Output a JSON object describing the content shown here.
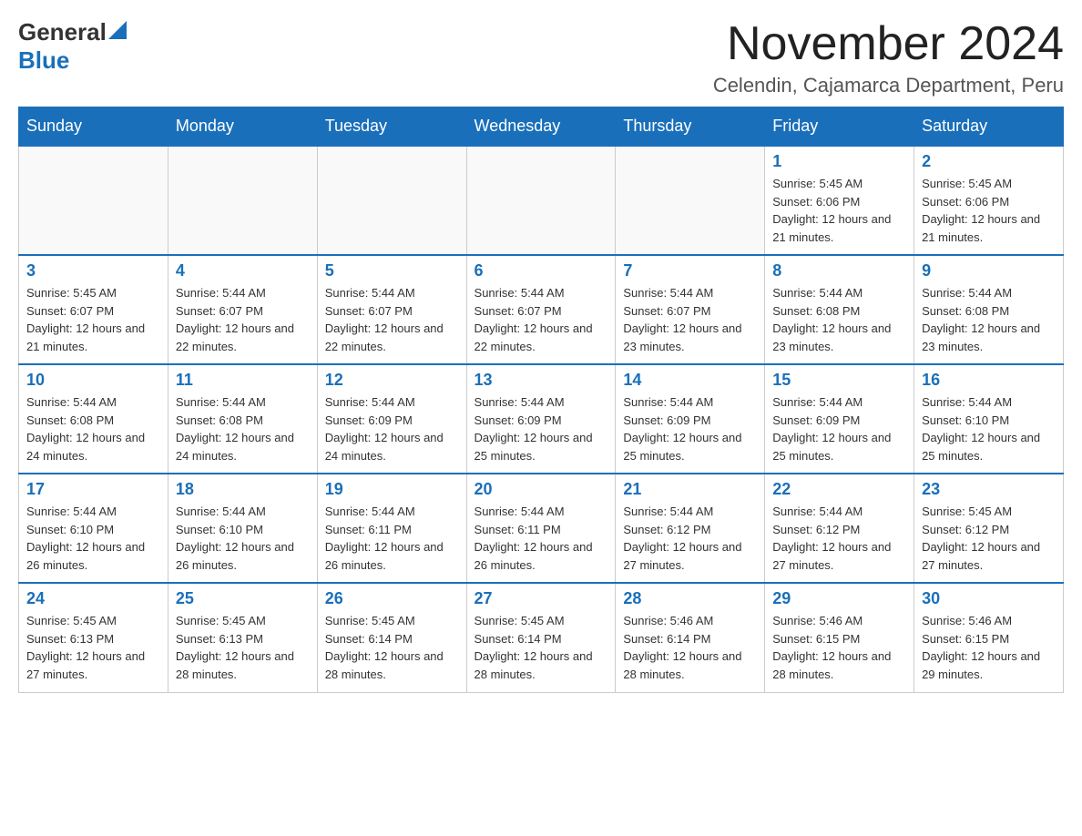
{
  "header": {
    "logo_general": "General",
    "logo_blue": "Blue",
    "month_title": "November 2024",
    "location": "Celendin, Cajamarca Department, Peru"
  },
  "days_of_week": [
    "Sunday",
    "Monday",
    "Tuesday",
    "Wednesday",
    "Thursday",
    "Friday",
    "Saturday"
  ],
  "weeks": [
    [
      {
        "day": "",
        "info": ""
      },
      {
        "day": "",
        "info": ""
      },
      {
        "day": "",
        "info": ""
      },
      {
        "day": "",
        "info": ""
      },
      {
        "day": "",
        "info": ""
      },
      {
        "day": "1",
        "info": "Sunrise: 5:45 AM\nSunset: 6:06 PM\nDaylight: 12 hours and 21 minutes."
      },
      {
        "day": "2",
        "info": "Sunrise: 5:45 AM\nSunset: 6:06 PM\nDaylight: 12 hours and 21 minutes."
      }
    ],
    [
      {
        "day": "3",
        "info": "Sunrise: 5:45 AM\nSunset: 6:07 PM\nDaylight: 12 hours and 21 minutes."
      },
      {
        "day": "4",
        "info": "Sunrise: 5:44 AM\nSunset: 6:07 PM\nDaylight: 12 hours and 22 minutes."
      },
      {
        "day": "5",
        "info": "Sunrise: 5:44 AM\nSunset: 6:07 PM\nDaylight: 12 hours and 22 minutes."
      },
      {
        "day": "6",
        "info": "Sunrise: 5:44 AM\nSunset: 6:07 PM\nDaylight: 12 hours and 22 minutes."
      },
      {
        "day": "7",
        "info": "Sunrise: 5:44 AM\nSunset: 6:07 PM\nDaylight: 12 hours and 23 minutes."
      },
      {
        "day": "8",
        "info": "Sunrise: 5:44 AM\nSunset: 6:08 PM\nDaylight: 12 hours and 23 minutes."
      },
      {
        "day": "9",
        "info": "Sunrise: 5:44 AM\nSunset: 6:08 PM\nDaylight: 12 hours and 23 minutes."
      }
    ],
    [
      {
        "day": "10",
        "info": "Sunrise: 5:44 AM\nSunset: 6:08 PM\nDaylight: 12 hours and 24 minutes."
      },
      {
        "day": "11",
        "info": "Sunrise: 5:44 AM\nSunset: 6:08 PM\nDaylight: 12 hours and 24 minutes."
      },
      {
        "day": "12",
        "info": "Sunrise: 5:44 AM\nSunset: 6:09 PM\nDaylight: 12 hours and 24 minutes."
      },
      {
        "day": "13",
        "info": "Sunrise: 5:44 AM\nSunset: 6:09 PM\nDaylight: 12 hours and 25 minutes."
      },
      {
        "day": "14",
        "info": "Sunrise: 5:44 AM\nSunset: 6:09 PM\nDaylight: 12 hours and 25 minutes."
      },
      {
        "day": "15",
        "info": "Sunrise: 5:44 AM\nSunset: 6:09 PM\nDaylight: 12 hours and 25 minutes."
      },
      {
        "day": "16",
        "info": "Sunrise: 5:44 AM\nSunset: 6:10 PM\nDaylight: 12 hours and 25 minutes."
      }
    ],
    [
      {
        "day": "17",
        "info": "Sunrise: 5:44 AM\nSunset: 6:10 PM\nDaylight: 12 hours and 26 minutes."
      },
      {
        "day": "18",
        "info": "Sunrise: 5:44 AM\nSunset: 6:10 PM\nDaylight: 12 hours and 26 minutes."
      },
      {
        "day": "19",
        "info": "Sunrise: 5:44 AM\nSunset: 6:11 PM\nDaylight: 12 hours and 26 minutes."
      },
      {
        "day": "20",
        "info": "Sunrise: 5:44 AM\nSunset: 6:11 PM\nDaylight: 12 hours and 26 minutes."
      },
      {
        "day": "21",
        "info": "Sunrise: 5:44 AM\nSunset: 6:12 PM\nDaylight: 12 hours and 27 minutes."
      },
      {
        "day": "22",
        "info": "Sunrise: 5:44 AM\nSunset: 6:12 PM\nDaylight: 12 hours and 27 minutes."
      },
      {
        "day": "23",
        "info": "Sunrise: 5:45 AM\nSunset: 6:12 PM\nDaylight: 12 hours and 27 minutes."
      }
    ],
    [
      {
        "day": "24",
        "info": "Sunrise: 5:45 AM\nSunset: 6:13 PM\nDaylight: 12 hours and 27 minutes."
      },
      {
        "day": "25",
        "info": "Sunrise: 5:45 AM\nSunset: 6:13 PM\nDaylight: 12 hours and 28 minutes."
      },
      {
        "day": "26",
        "info": "Sunrise: 5:45 AM\nSunset: 6:14 PM\nDaylight: 12 hours and 28 minutes."
      },
      {
        "day": "27",
        "info": "Sunrise: 5:45 AM\nSunset: 6:14 PM\nDaylight: 12 hours and 28 minutes."
      },
      {
        "day": "28",
        "info": "Sunrise: 5:46 AM\nSunset: 6:14 PM\nDaylight: 12 hours and 28 minutes."
      },
      {
        "day": "29",
        "info": "Sunrise: 5:46 AM\nSunset: 6:15 PM\nDaylight: 12 hours and 28 minutes."
      },
      {
        "day": "30",
        "info": "Sunrise: 5:46 AM\nSunset: 6:15 PM\nDaylight: 12 hours and 29 minutes."
      }
    ]
  ]
}
